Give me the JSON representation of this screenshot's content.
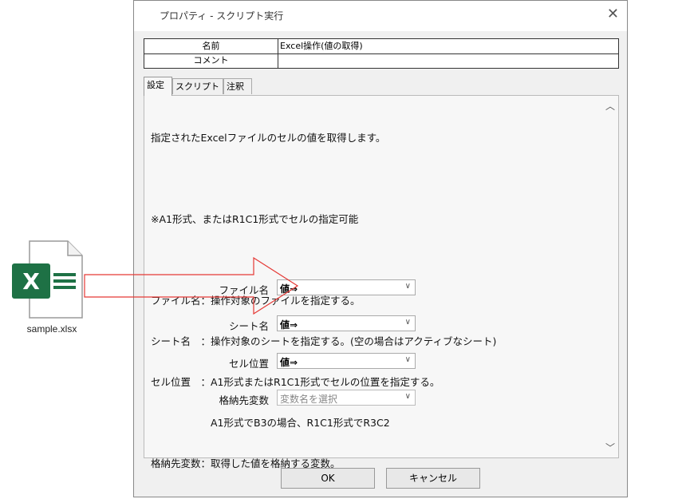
{
  "file": {
    "name": "sample.xlsx",
    "icon": "excel-file-icon",
    "brand_color": "#1e7145"
  },
  "dialog": {
    "title": "プロパティ - スクリプト実行",
    "close_label": "✕",
    "props": {
      "name_label": "名前",
      "name_value": "Excel操作(値の取得)",
      "comment_label": "コメント",
      "comment_value": ""
    },
    "tabs": [
      {
        "label": "設定",
        "active": true
      },
      {
        "label": "スクリプト",
        "active": false
      },
      {
        "label": "注釈",
        "active": false
      }
    ],
    "description": [
      "指定されたExcelファイルのセルの値を取得します。",
      "",
      "※A1形式、またはR1C1形式でセルの指定可能",
      "",
      "ファイル名：操作対象のファイルを指定する。",
      "シート名　：操作対象のシートを指定する。(空の場合はアクティブなシート)",
      "セル位置　：A1形式またはR1C1形式でセルの位置を指定する。",
      "　　　　　　A1形式でB3の場合、R1C1形式でR3C2",
      "格納先変数：取得した値を格納する変数。"
    ],
    "fields": [
      {
        "label": "ファイル名",
        "value": "値⇒",
        "placeholder": ""
      },
      {
        "label": "シート名",
        "value": "値⇒",
        "placeholder": ""
      },
      {
        "label": "セル位置",
        "value": "値⇒",
        "placeholder": ""
      },
      {
        "label": "格納先変数",
        "value": "",
        "placeholder": "変数名を選択"
      }
    ],
    "ok_label": "OK",
    "cancel_label": "キャンセル"
  },
  "colors": {
    "arrow": "#e53935",
    "excel_green": "#1e7145"
  }
}
